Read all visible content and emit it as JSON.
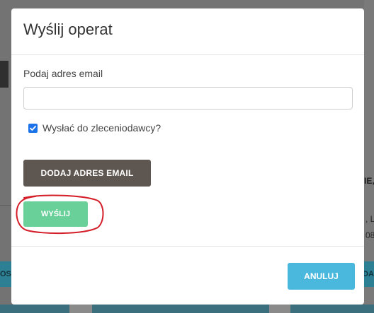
{
  "background": {
    "right_text_1": "IE,",
    "right_text_2": ", L",
    "right_text_3": "08",
    "left_strip_text": "OSE",
    "right_strip_text": "DAZ"
  },
  "modal": {
    "title": "Wyślij operat",
    "email_label": "Podaj adres email",
    "email_value": "",
    "email_placeholder": "",
    "checkbox_label": "Wysłać do zleceniodawcy?",
    "checkbox_checked": true,
    "add_email_button": "DODAJ ADRES EMAIL",
    "send_button": "WYŚLIJ",
    "cancel_button": "ANULUJ"
  },
  "colors": {
    "add_button": "#5e5650",
    "send_button": "#68d098",
    "cancel_button": "#4ab8dd",
    "checkbox": "#1a73e8",
    "highlight": "#d41f2a"
  }
}
